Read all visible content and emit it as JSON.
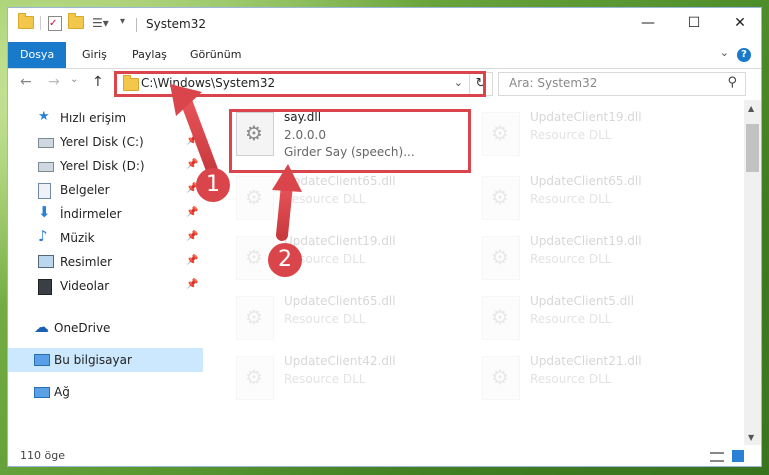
{
  "window": {
    "title": "System32",
    "controls": {
      "minimize": "—",
      "maximize": "☐",
      "close": "✕"
    }
  },
  "ribbon": {
    "tabs": [
      "Dosya",
      "Giriş",
      "Paylaş",
      "Görünüm"
    ],
    "active_tab": "Dosya",
    "help": "?"
  },
  "nav": {
    "back": "←",
    "forward": "→",
    "up": "↑",
    "address": "C:\\Windows\\System32",
    "refresh": "↻",
    "search_placeholder": "Ara: System32"
  },
  "sidebar": {
    "items": [
      {
        "label": "Hızlı erişim",
        "icon": "star-icon"
      },
      {
        "label": "Yerel Disk (C:)",
        "icon": "drive-icon"
      },
      {
        "label": "Yerel Disk (D:)",
        "icon": "drive-icon"
      },
      {
        "label": "Belgeler",
        "icon": "documents-icon"
      },
      {
        "label": "İndirmeler",
        "icon": "download-icon"
      },
      {
        "label": "Müzik",
        "icon": "music-icon"
      },
      {
        "label": "Resimler",
        "icon": "pictures-icon"
      },
      {
        "label": "Videolar",
        "icon": "video-icon"
      },
      {
        "label": "OneDrive",
        "icon": "cloud-icon"
      },
      {
        "label": "Bu bilgisayar",
        "icon": "computer-icon"
      },
      {
        "label": "Ağ",
        "icon": "network-icon"
      }
    ],
    "selected": "Bu bilgisayar"
  },
  "files": [
    {
      "name": "say.dll",
      "line2": "2.0.0.0",
      "line3": "Girder Say (speech)...",
      "highlighted": true
    },
    {
      "name": "UpdateClient19.dll",
      "line2": "Resource DLL"
    },
    {
      "name": "UpdateClient65.dll",
      "line2": "Resource DLL"
    },
    {
      "name": "UpdateClient65.dll",
      "line2": "Resource DLL"
    },
    {
      "name": "UpdateClient19.dll",
      "line2": "Resource DLL"
    },
    {
      "name": "UpdateClient19.dll",
      "line2": "Resource DLL"
    },
    {
      "name": "UpdateClient65.dll",
      "line2": "Resource DLL"
    },
    {
      "name": "UpdateClient5.dll",
      "line2": "Resource DLL"
    },
    {
      "name": "UpdateClient42.dll",
      "line2": "Resource DLL"
    },
    {
      "name": "UpdateClient21.dll",
      "line2": "Resource DLL"
    }
  ],
  "status": {
    "item_count": "110 öge"
  },
  "callouts": [
    "1",
    "2"
  ],
  "colors": {
    "accent": "#1979ca",
    "highlight": "#d9454a",
    "selection": "#cce8ff"
  }
}
